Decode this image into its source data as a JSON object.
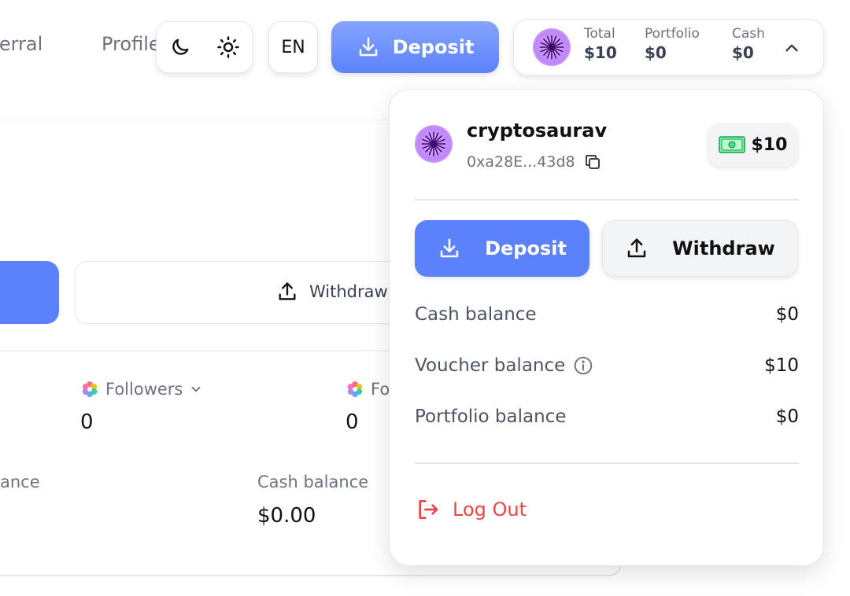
{
  "nav": {
    "links": [
      "Referral",
      "Profile"
    ],
    "language": "EN",
    "deposit_label": "Deposit"
  },
  "wallet_summary": {
    "total_label": "Total",
    "total_value": "$10",
    "portfolio_label": "Portfolio",
    "portfolio_value": "$0",
    "cash_label": "Cash",
    "cash_value": "$0"
  },
  "background": {
    "withdraw_label": "Withdraw",
    "followers_label": "Followers",
    "followers_value": "0",
    "following_label": "Fo",
    "following_value": "0",
    "balance_fragment": "ance",
    "cash_balance_label": "Cash balance",
    "cash_balance_value": "$0.00"
  },
  "account": {
    "username": "cryptosaurav",
    "address": "0xa28E...43d8",
    "voucher_amount": "$10",
    "deposit_label": "Deposit",
    "withdraw_label": "Withdraw",
    "balances": [
      {
        "label": "Cash balance",
        "value": "$0"
      },
      {
        "label": "Voucher balance",
        "value": "$10"
      },
      {
        "label": "Portfolio balance",
        "value": "$0"
      }
    ],
    "logout_label": "Log Out"
  },
  "colors": {
    "accent": "#5b82fb",
    "danger": "#ef4444",
    "muted": "#6b7280"
  },
  "icons": [
    "moon-icon",
    "sun-icon",
    "download-icon",
    "upload-icon",
    "copy-icon",
    "cash-icon",
    "info-icon",
    "chevron-up-icon",
    "chevron-down-icon",
    "logout-icon",
    "flower-icon"
  ]
}
